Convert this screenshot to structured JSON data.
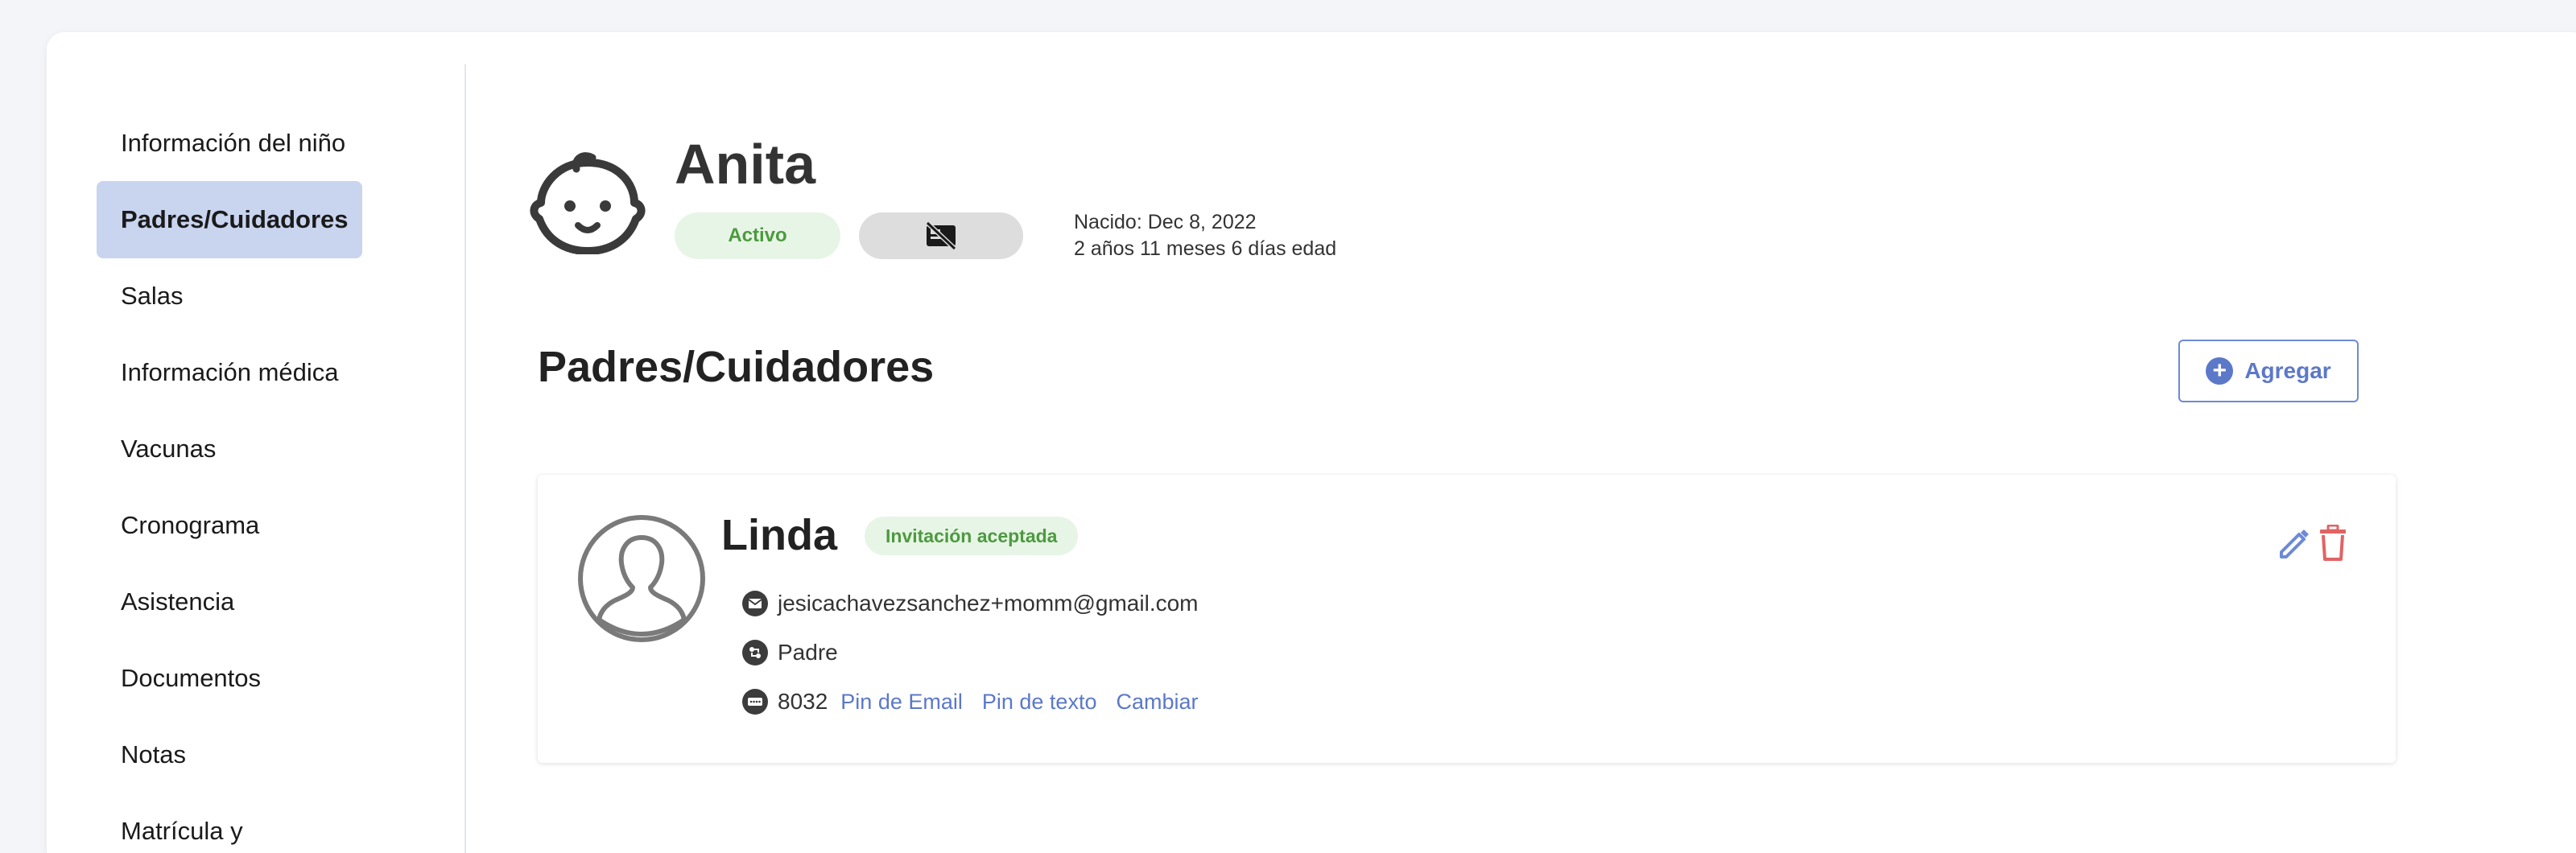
{
  "sidebar": {
    "items": [
      {
        "label": "Información del niño"
      },
      {
        "label": "Padres/Cuidadores",
        "active": true
      },
      {
        "label": "Salas"
      },
      {
        "label": "Información médica"
      },
      {
        "label": "Vacunas"
      },
      {
        "label": "Cronograma"
      },
      {
        "label": "Asistencia"
      },
      {
        "label": "Documentos"
      },
      {
        "label": "Notas"
      },
      {
        "label": "Matrícula y"
      }
    ]
  },
  "child": {
    "name": "Anita",
    "status": "Activo",
    "born": "Nacido: Dec 8, 2022",
    "age": "2 años 11 meses 6 días edad",
    "icons": {
      "avatar": "baby-face-icon",
      "photo": "no-photo-icon"
    }
  },
  "section": {
    "title": "Padres/Cuidadores",
    "add_label": "Agregar"
  },
  "parents": [
    {
      "name": "Linda",
      "badge": "Invitación aceptada",
      "email": "jesicachavezsanchez+momm@gmail.com",
      "relation": "Padre",
      "pin": "8032",
      "pin_email_label": "Pin de Email",
      "pin_text_label": "Pin de texto",
      "change_label": "Cambiar"
    }
  ],
  "colors": {
    "accent": "#5c78c8",
    "active_nav": "#c9d4ef",
    "success_bg": "#e7f5e6",
    "success_text": "#4c9a3f",
    "danger": "#e06464"
  }
}
